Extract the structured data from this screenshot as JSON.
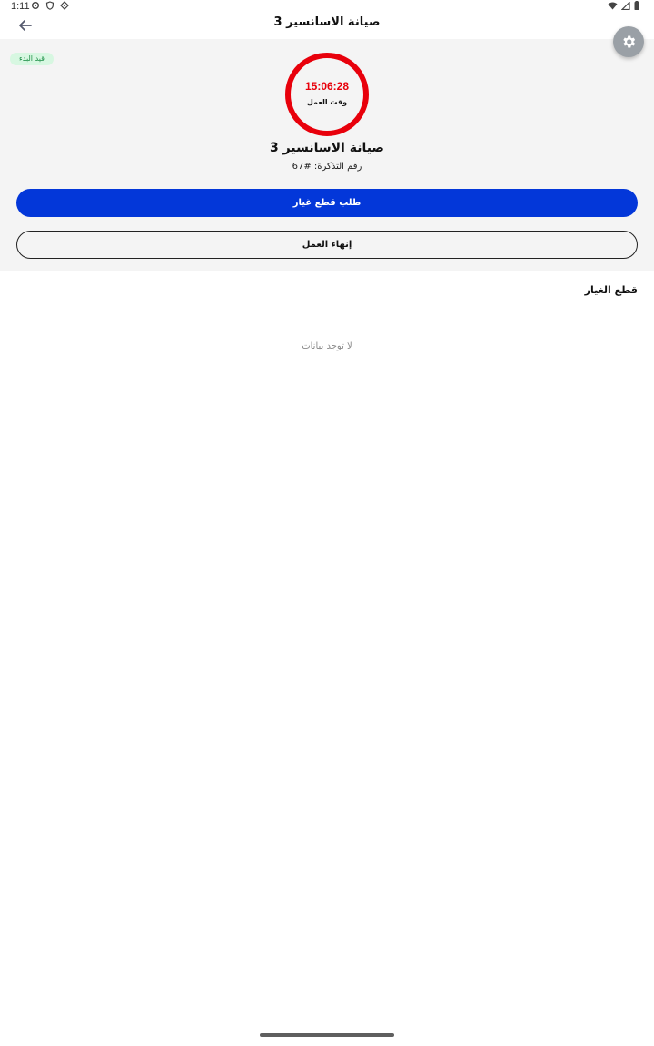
{
  "status_bar": {
    "time": "1:11",
    "left_icons": [
      "gear-icon",
      "shield-icon",
      "diamond-icon"
    ],
    "right_icons": [
      "wifi-icon",
      "signal-icon",
      "battery-icon"
    ]
  },
  "app_bar": {
    "title": "صيانة الاسانسير 3",
    "back_icon": "arrow-left-icon"
  },
  "header": {
    "status_badge": "قيد البدء",
    "timer": {
      "value": "15:06:28",
      "label": "وقت العمل",
      "color": "#e8000b"
    },
    "task_title": "صيانة الاسانسير 3",
    "ticket_number": "رقم التذكرة: #67",
    "settings_icon": "gear-icon"
  },
  "actions": {
    "request_parts_label": "طلب قطع غيار",
    "finish_work_label": "إنهاء العمل",
    "primary_color": "#0337d9"
  },
  "parts_section": {
    "title": "قطع الغيار",
    "empty_text": "لا توجد بيانات"
  }
}
